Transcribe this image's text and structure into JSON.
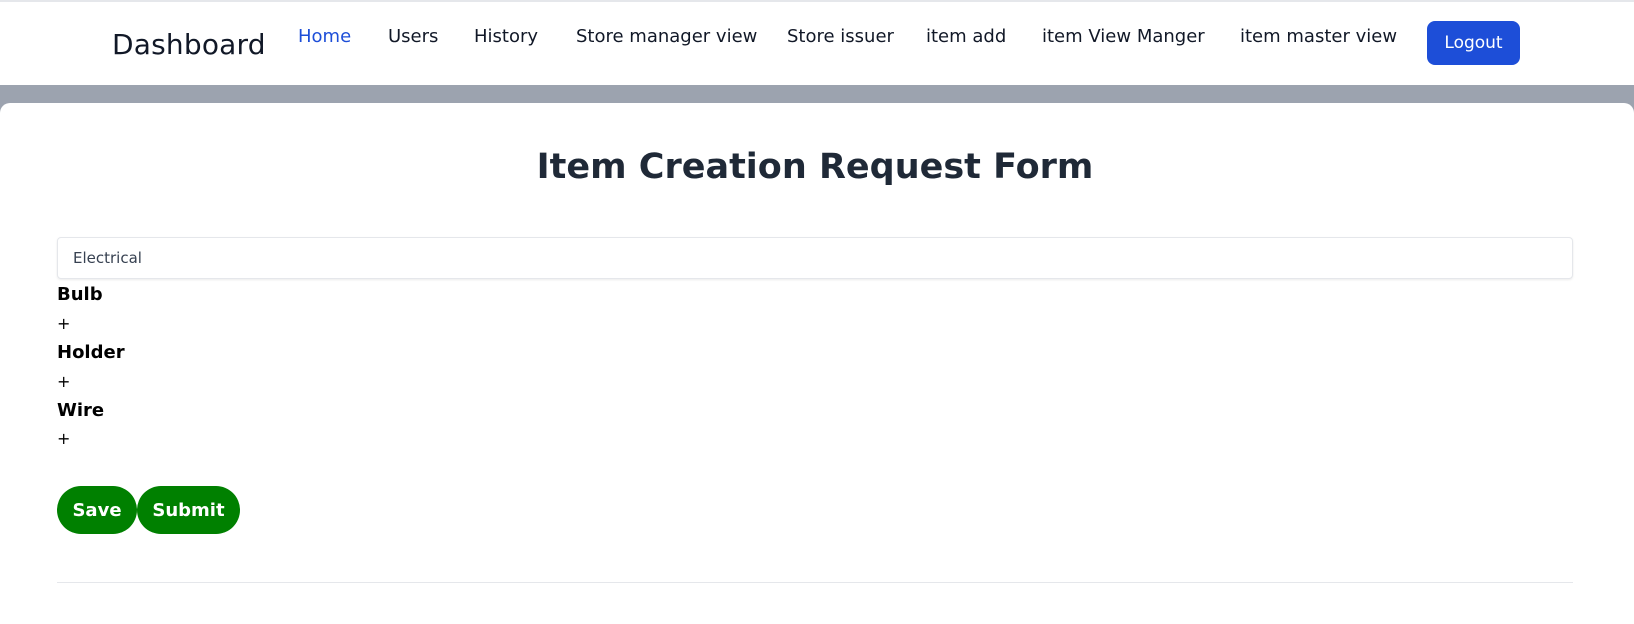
{
  "header": {
    "brand": "Dashboard",
    "nav": [
      {
        "label": "Home"
      },
      {
        "label": "Users"
      },
      {
        "label": "History"
      },
      {
        "label": "Store manager view"
      },
      {
        "label": "Store issuer"
      },
      {
        "label": "item add"
      },
      {
        "label": "item View Manger"
      },
      {
        "label": "item master view"
      }
    ],
    "active_nav": "Home",
    "logout_label": "Logout"
  },
  "form": {
    "title": "Item Creation Request Form",
    "category_value": "Electrical",
    "items": [
      {
        "name": "Bulb",
        "add_symbol": "+"
      },
      {
        "name": "Holder",
        "add_symbol": "+"
      },
      {
        "name": "Wire",
        "add_symbol": "+"
      }
    ],
    "save_label": "Save",
    "submit_label": "Submit"
  },
  "colors": {
    "accent": "#1d4ed8",
    "button_green": "#008000",
    "band": "#9ca3af"
  }
}
